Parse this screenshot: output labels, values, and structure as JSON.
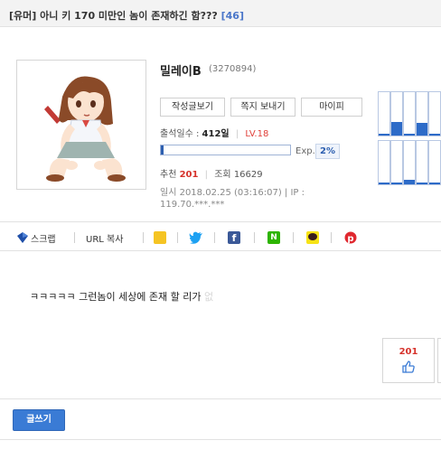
{
  "post": {
    "title": "[유머] 아니 키 170 미만인 놈이 존재하긴 함???",
    "comment_count": "[46]"
  },
  "author": {
    "nickname": "밀레이B",
    "user_id": "(3270894)",
    "buttons": {
      "view_posts": "작성글보기",
      "send_note": "쪽지 보내기",
      "mypi": "마이피"
    },
    "attendance_label": "출석일수 :",
    "attendance_value": "412일",
    "level": "LV.18",
    "exp_label": "Exp.",
    "exp_percent": "2%",
    "exp_fraction": 0.02,
    "recommend_label": "추천",
    "recommend_value": "201",
    "views_label": "조회",
    "views_value": "16629",
    "datetime": "일시 2018.02.25 (03:16:07)",
    "ip": "IP : 119.70.***.***",
    "activity_bars": [
      0.0,
      0.32,
      0.0,
      0.3,
      0.0,
      0.0,
      0.0,
      0.1,
      0.0,
      0.0
    ]
  },
  "share": {
    "scrap": "스크랩",
    "url_copy": "URL 복사",
    "icons": [
      "mypeople-icon",
      "twitter-icon",
      "facebook-icon",
      "naver-icon",
      "kakao-icon",
      "pinterest-icon"
    ]
  },
  "body": {
    "text": "ㅋㅋㅋㅋㅋ 그런놈이 세상에 존재 할 리가 ",
    "faded": "없"
  },
  "recommend": {
    "count": "201"
  },
  "actions": {
    "write": "글쓰기"
  },
  "colors": {
    "accent": "#3a7bd5",
    "red": "#d6322b",
    "bar": "#2d6bc8"
  }
}
